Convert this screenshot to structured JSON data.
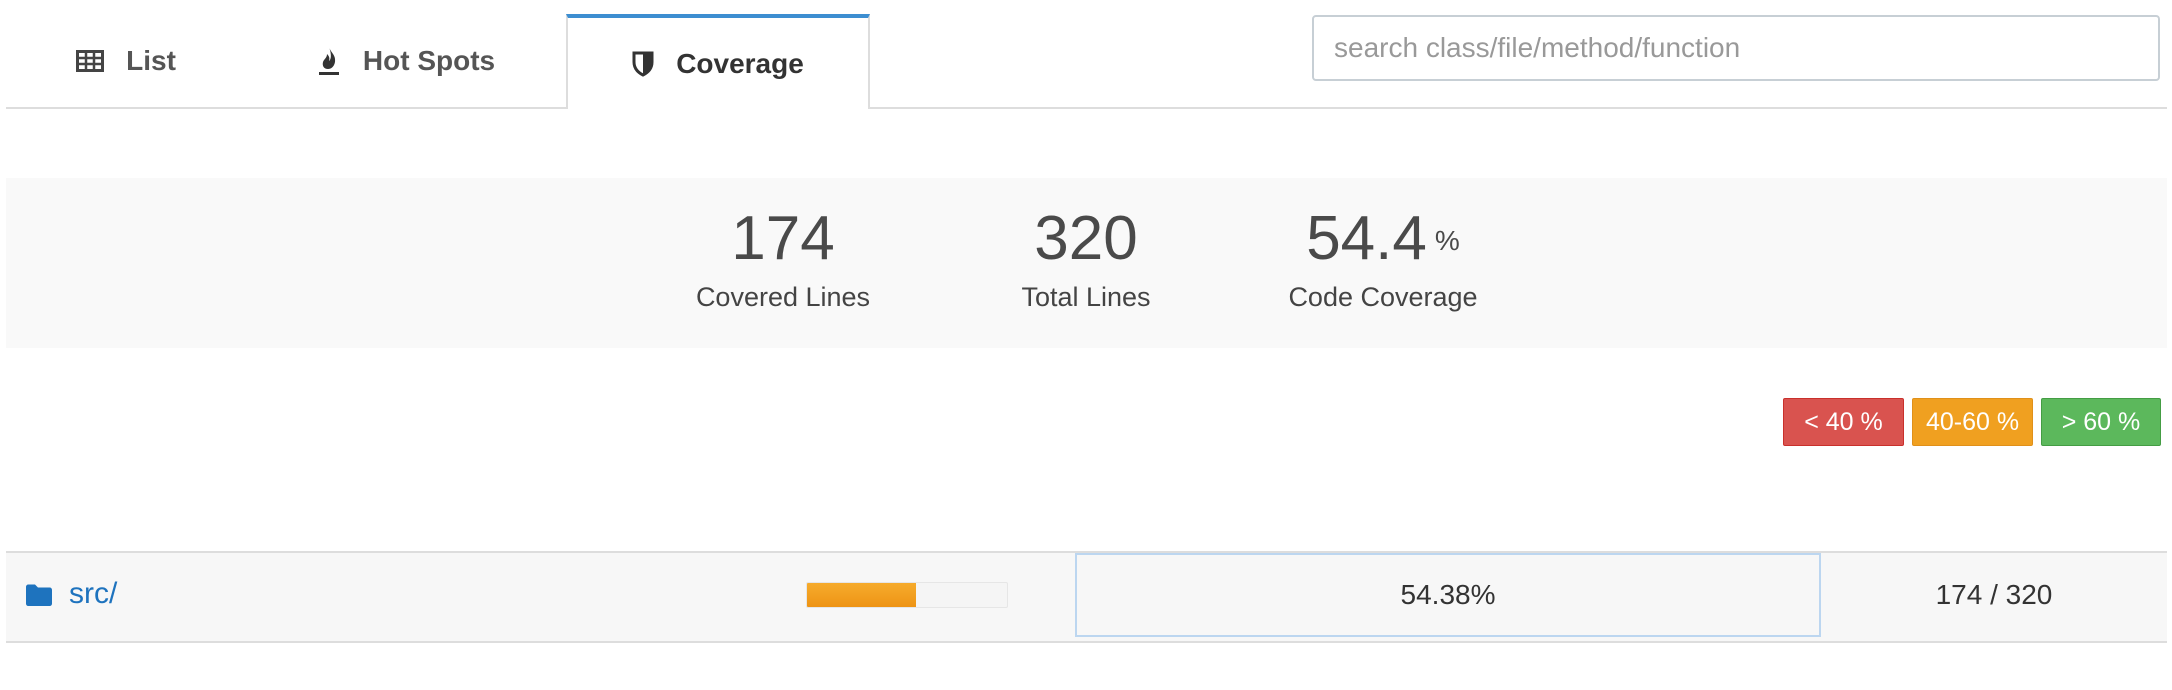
{
  "tabs": [
    {
      "label": "List",
      "icon": "table-icon",
      "active": false
    },
    {
      "label": "Hot Spots",
      "icon": "fire-icon",
      "active": false
    },
    {
      "label": "Coverage",
      "icon": "shield-icon",
      "active": true
    }
  ],
  "search": {
    "placeholder": "search class/file/method/function",
    "value": ""
  },
  "stats": {
    "covered_lines": {
      "value": "174",
      "label": "Covered Lines"
    },
    "total_lines": {
      "value": "320",
      "label": "Total Lines"
    },
    "code_coverage": {
      "value": "54.4",
      "unit": "%",
      "label": "Code Coverage"
    }
  },
  "legend": {
    "low": "< 40 %",
    "mid": "40-60 %",
    "high": "> 60 %"
  },
  "colors": {
    "accent": "#3d8ed1",
    "low": "#d9534f",
    "mid": "#f0a020",
    "high": "#5cb85c",
    "link": "#1e73be"
  },
  "rows": [
    {
      "name": "src/",
      "icon": "folder-icon",
      "coverage_fraction": 0.5438,
      "coverage_text": "54.38%",
      "lines_text": "174 / 320"
    }
  ]
}
